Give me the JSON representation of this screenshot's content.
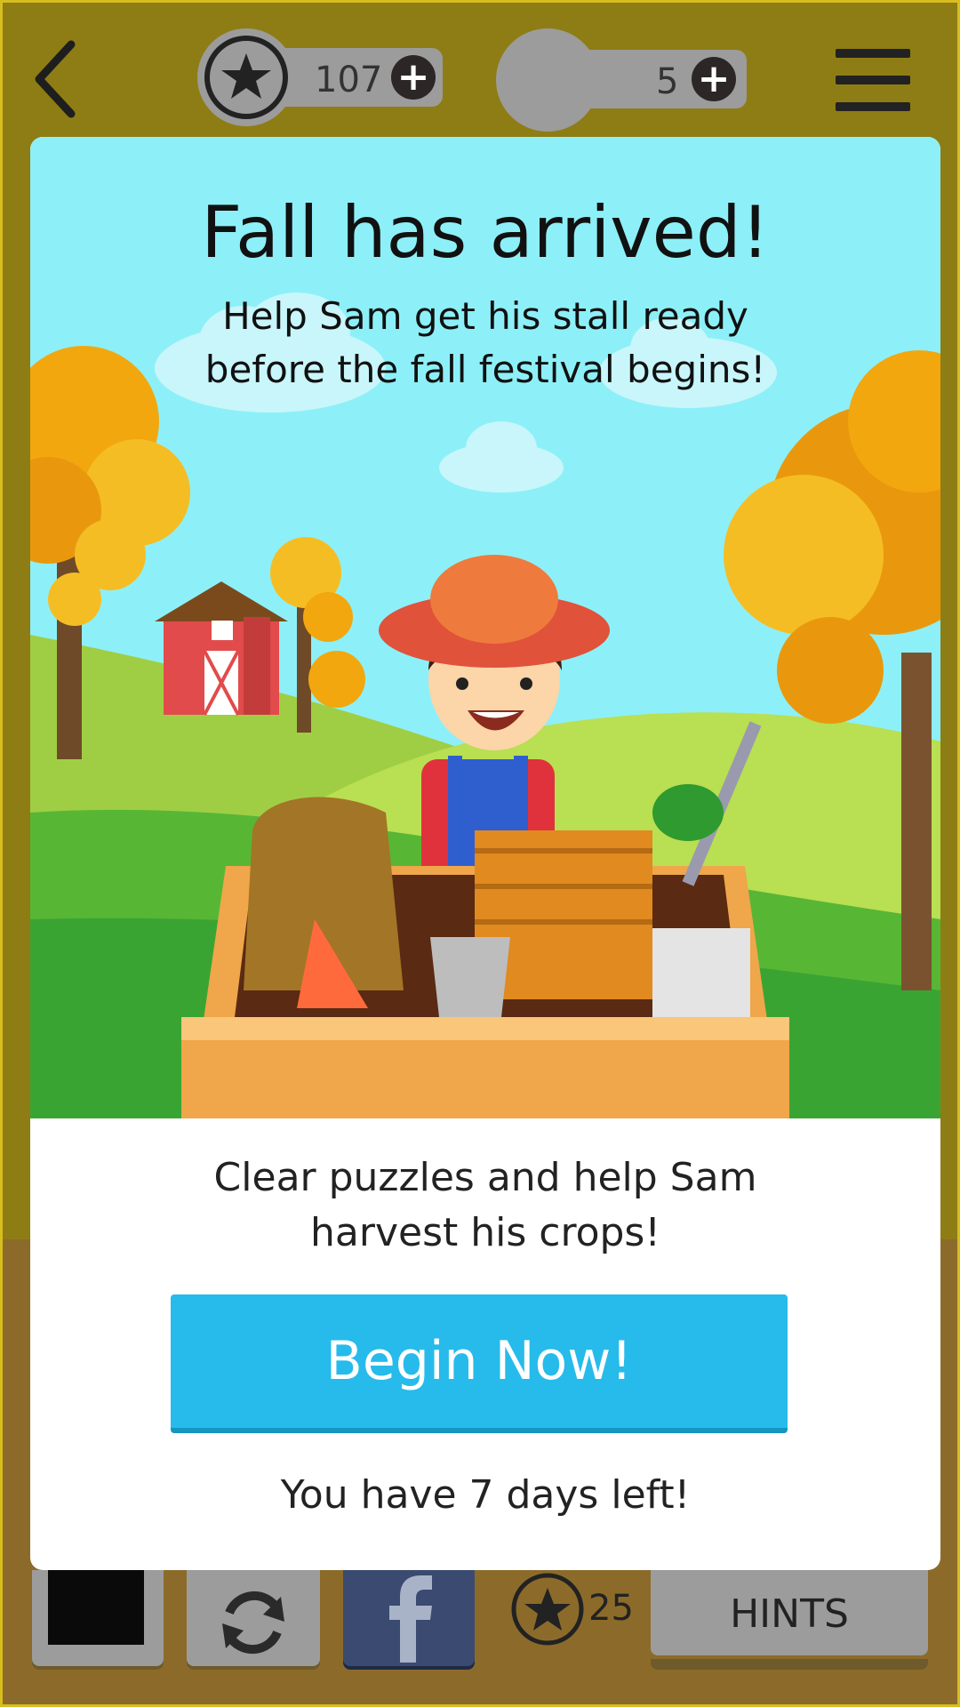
{
  "top_bar": {
    "coins": "107",
    "lives": "5",
    "plus_symbol": "+",
    "back_icon": "chevron-left-icon",
    "menu_icon": "hamburger-menu-icon"
  },
  "modal": {
    "title": "Fall has arrived!",
    "subtitle": "Help Sam get his stall ready before the fall festival begins!",
    "body": "Clear puzzles and help Sam harvest his crops!",
    "button_label": "Begin Now!",
    "days_left": "You have 7 days left!"
  },
  "toolbar": {
    "hint_count": "25",
    "hints_label": "HINTS",
    "icons": [
      "color-swatch-icon",
      "refresh-icon",
      "facebook-icon",
      "star-coin-icon"
    ]
  },
  "colors": {
    "background_top": "#8e7d14",
    "background_bottom": "#8c6b2a",
    "button_blue": "#26bbea",
    "sky": "#8df0f8",
    "facebook_blue": "#3b4a70"
  }
}
